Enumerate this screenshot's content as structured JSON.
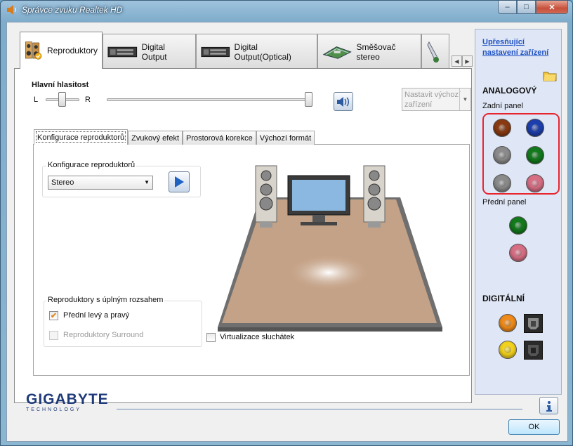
{
  "window": {
    "title": "Správce zvuku Realtek HD"
  },
  "titlebar": {
    "min": "–",
    "max": "□",
    "close": "✕"
  },
  "tabs": [
    {
      "label": "Reproduktory",
      "icon": "speaker-icon"
    },
    {
      "label": "Digital Output",
      "icon": "digital-output-icon"
    },
    {
      "label": "Digital Output(Optical)",
      "icon": "optical-output-icon"
    },
    {
      "label": "Směšovač stereo",
      "icon": "mixer-icon"
    }
  ],
  "volume": {
    "title": "Hlavní hlasitost",
    "left": "L",
    "right": "R",
    "balance": 0.5,
    "level": 1.0
  },
  "set_default": {
    "label": "Nastavit výchozí zařízení"
  },
  "subtabs": [
    "Konfigurace reproduktorů",
    "Zvukový efekt",
    "Prostorová korekce",
    "Výchozí formát"
  ],
  "config": {
    "group_label": "Konfigurace reproduktorů",
    "selected": "Stereo"
  },
  "fullrange": {
    "group_label": "Reproduktory s úplným rozsahem",
    "front": "Přední levý a pravý",
    "surround": "Reproduktory Surround"
  },
  "virtualization": "Virtualizace sluchátek",
  "right_panel": {
    "link": "Upřesňující nastavení zařízení",
    "analog_title": "ANALOGOVÝ",
    "rear_panel": "Zadní panel",
    "front_panel": "Přední panel",
    "digital_title": "DIGITÁLNÍ",
    "rear_jacks": [
      "#8a3a12",
      "#1d3fae",
      "#8b8b8b",
      "#127a1c",
      "#8b8b8b",
      "#d76e84"
    ],
    "front_jacks": [
      "#127a1c",
      "#d76e84"
    ]
  },
  "brand": {
    "name": "GIGABYTE",
    "sub": "TECHNOLOGY"
  },
  "ok": "OK"
}
